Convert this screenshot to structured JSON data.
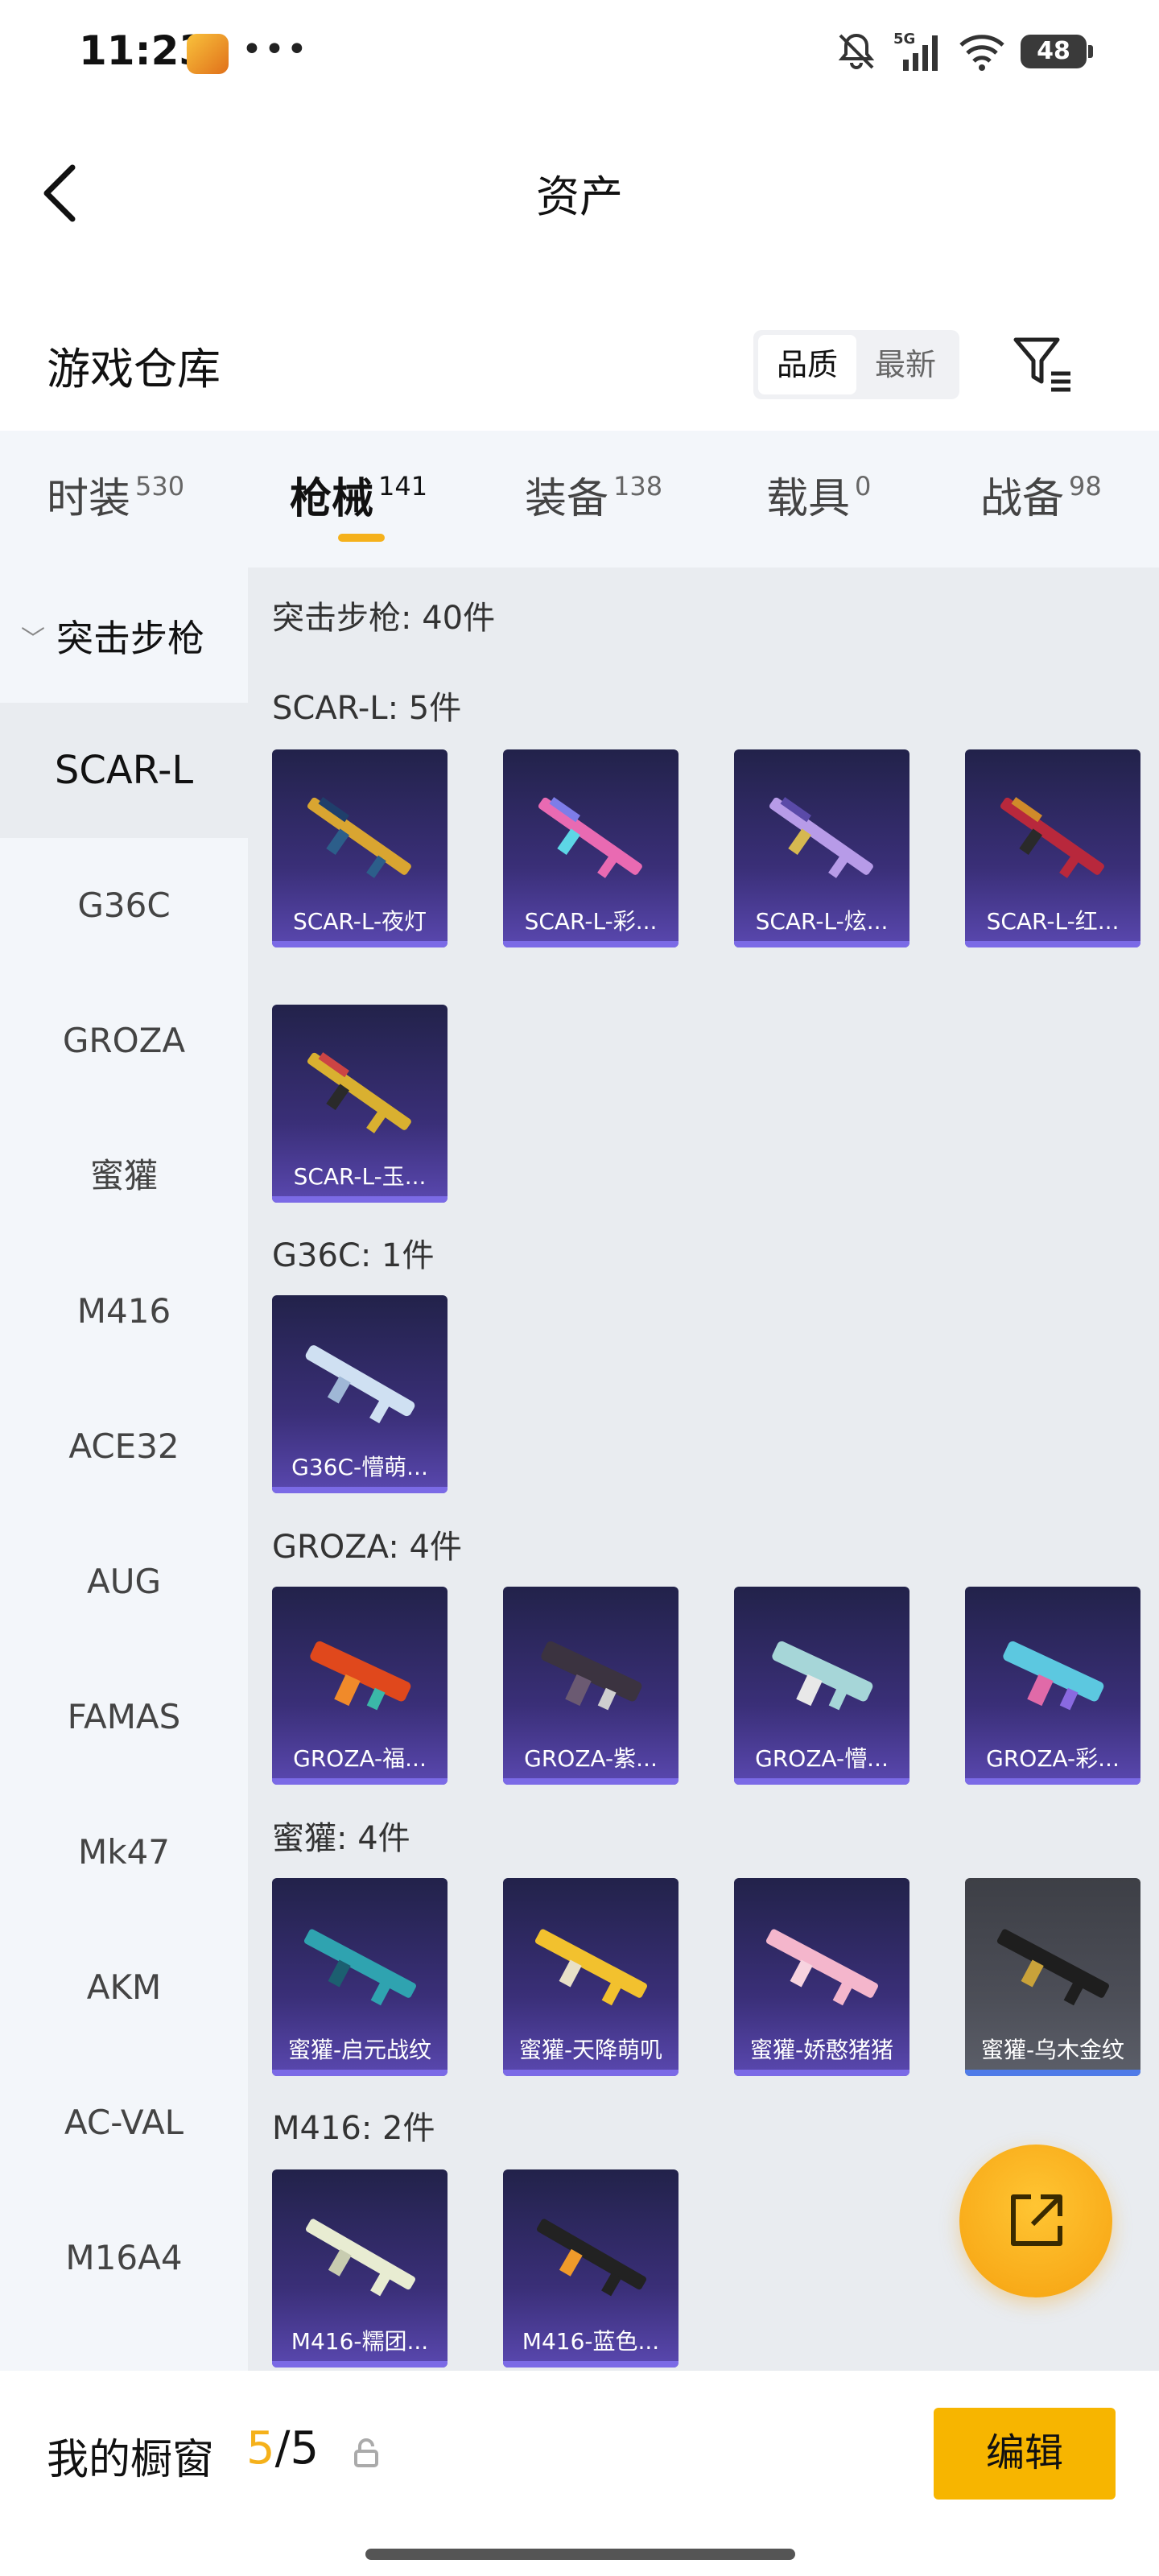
{
  "status_bar": {
    "time": "11:23",
    "dots": "•••",
    "battery": "48",
    "network": "5G"
  },
  "header": {
    "title": "资产"
  },
  "warehouse": {
    "title": "游戏仓库",
    "sort_options": [
      "品质",
      "最新"
    ],
    "active_sort": "品质"
  },
  "tabs": [
    {
      "label": "时装",
      "count": "530"
    },
    {
      "label": "枪械",
      "count": "141",
      "active": true
    },
    {
      "label": "装备",
      "count": "138"
    },
    {
      "label": "载具",
      "count": "0"
    },
    {
      "label": "战备",
      "count": "98"
    }
  ],
  "sidebar": {
    "header": "突击步枪",
    "items": [
      "SCAR-L",
      "G36C",
      "GROZA",
      "蜜獾",
      "M416",
      "ACE32",
      "AUG",
      "FAMAS",
      "Mk47",
      "AKM",
      "AC-VAL",
      "M16A4"
    ],
    "active": "SCAR-L"
  },
  "content": {
    "category_total": "突击步枪: 40件",
    "sections": [
      {
        "title": "SCAR-L: 5件",
        "items": [
          "SCAR-L-夜灯",
          "SCAR-L-彩...",
          "SCAR-L-炫...",
          "SCAR-L-红...",
          "SCAR-L-玉..."
        ]
      },
      {
        "title": "G36C: 1件",
        "items": [
          "G36C-懵萌..."
        ]
      },
      {
        "title": "GROZA: 4件",
        "items": [
          "GROZA-福...",
          "GROZA-紫...",
          "GROZA-懵...",
          "GROZA-彩..."
        ]
      },
      {
        "title": "蜜獾: 4件",
        "items": [
          "蜜獾-启元战纹",
          "蜜獾-天降萌叽",
          "蜜獾-娇憨猪猪",
          "蜜獾-乌木金纹"
        ]
      },
      {
        "title": "M416: 2件",
        "items": [
          "M416-糯团...",
          "M416-蓝色..."
        ]
      }
    ]
  },
  "bottom_bar": {
    "label": "我的橱窗",
    "used": "5",
    "sep_total": "/5",
    "edit": "编辑"
  },
  "colors": {
    "accent": "#f5b11b",
    "card_purple": "#3a2f78",
    "card_gray": "#4c4e57"
  }
}
